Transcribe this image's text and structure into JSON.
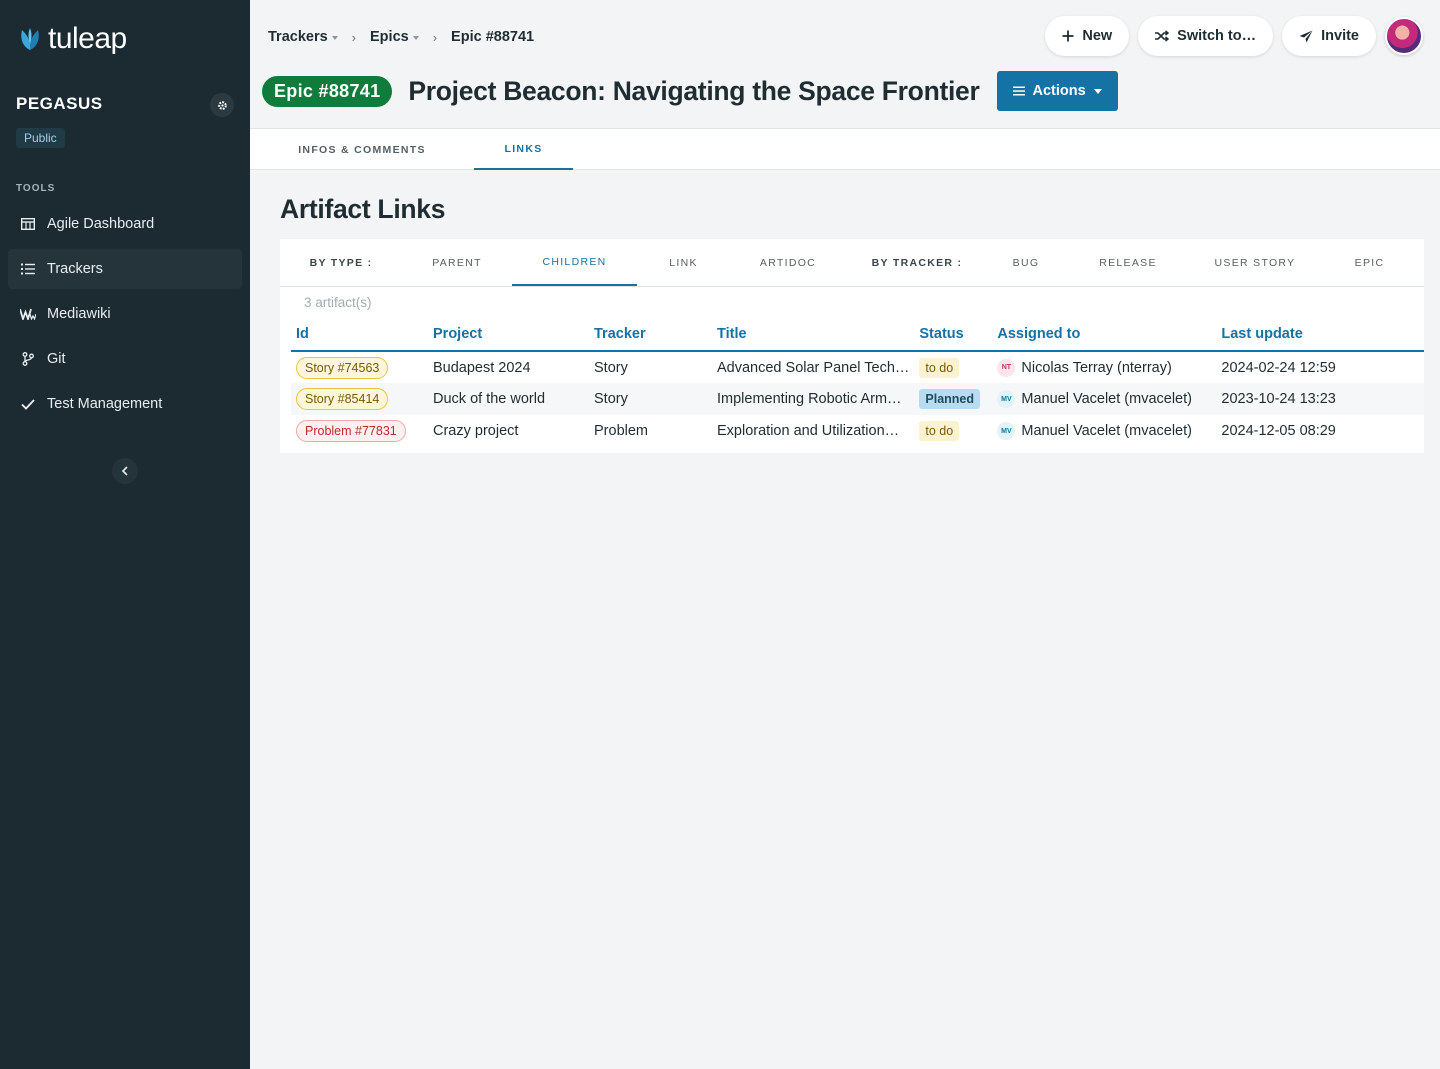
{
  "sidebar": {
    "logo_text": "tuleap",
    "project_name": "PEGASUS",
    "visibility": "Public",
    "tools_label": "TOOLS",
    "items": [
      {
        "label": "Agile Dashboard",
        "icon": "table-icon"
      },
      {
        "label": "Trackers",
        "icon": "list-icon"
      },
      {
        "label": "Mediawiki",
        "icon": "wiki-icon"
      },
      {
        "label": "Git",
        "icon": "git-branch-icon"
      },
      {
        "label": "Test Management",
        "icon": "check-icon"
      }
    ],
    "active_item": "Trackers"
  },
  "header": {
    "breadcrumb": [
      "Trackers",
      "Epics",
      "Epic #88741"
    ],
    "buttons": {
      "new": "New",
      "switch": "Switch to…",
      "invite": "Invite"
    },
    "artifact_id": "Epic #88741",
    "artifact_title": "Project Beacon: Navigating the Space Frontier",
    "actions_label": "Actions"
  },
  "tabs": [
    {
      "label": "INFOS & COMMENTS",
      "active": false
    },
    {
      "label": "LINKS",
      "active": true
    }
  ],
  "links": {
    "section_title": "Artifact Links",
    "filters": {
      "by_type_label": "BY TYPE :",
      "types": [
        "PARENT",
        "CHILDREN",
        "LINK",
        "ARTIDOC"
      ],
      "active_type": "CHILDREN",
      "by_tracker_label": "BY TRACKER :",
      "trackers": [
        "BUG",
        "RELEASE",
        "USER STORY",
        "EPIC"
      ]
    },
    "count_text": "3 artifact(s)",
    "columns": [
      "Id",
      "Project",
      "Tracker",
      "Title",
      "Status",
      "Assigned to",
      "Last update"
    ],
    "rows": [
      {
        "id": "Story #74563",
        "id_kind": "story",
        "project": "Budapest 2024",
        "tracker": "Story",
        "title": "Advanced Solar Panel Tech…",
        "status": "to do",
        "status_kind": "todo",
        "assignee_initials": "NT",
        "assignee": "Nicolas Terray (nterray)",
        "last_update": "2024-02-24 12:59"
      },
      {
        "id": "Story #85414",
        "id_kind": "story",
        "project": "Duck of the world",
        "tracker": "Story",
        "title": "Implementing Robotic Arm…",
        "status": "Planned",
        "status_kind": "planned",
        "assignee_initials": "MV",
        "assignee": "Manuel Vacelet (mvacelet)",
        "last_update": "2023-10-24 13:23"
      },
      {
        "id": "Problem #77831",
        "id_kind": "problem",
        "project": "Crazy project",
        "tracker": "Problem",
        "title": "Exploration and Utilization…",
        "status": "to do",
        "status_kind": "todo",
        "assignee_initials": "MV",
        "assignee": "Manuel Vacelet (mvacelet)",
        "last_update": "2024-12-05 08:29"
      }
    ]
  },
  "colors": {
    "sidebar_bg": "#1c2a31",
    "accent": "#1472a5",
    "epic_badge": "#107c3c",
    "story_badge": "#e8c53f",
    "problem_badge": "#f0a7a7"
  }
}
